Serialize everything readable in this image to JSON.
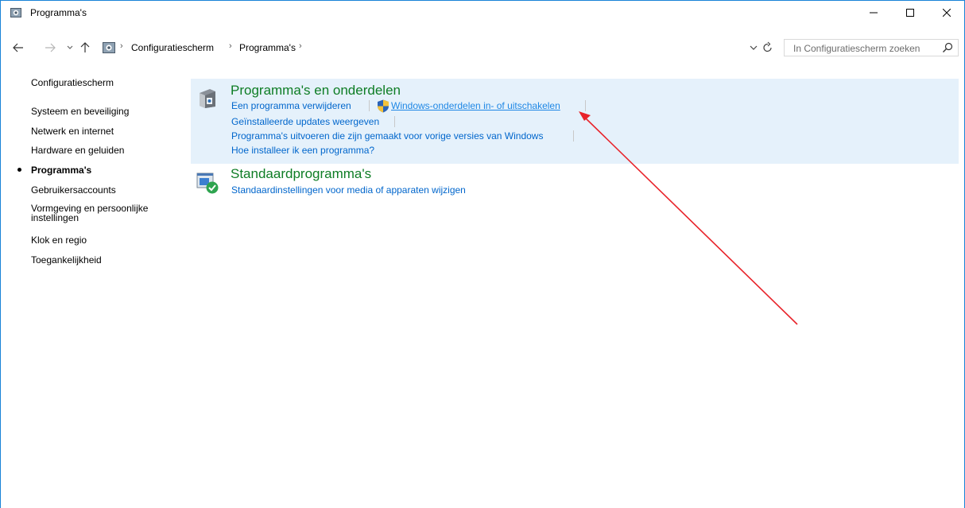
{
  "window": {
    "title": "Programma's",
    "minimize_icon": "minimize-icon",
    "maximize_icon": "maximize-icon",
    "close_icon": "close-icon"
  },
  "address_bar": {
    "breadcrumbs": [
      "Configuratiescherm",
      "Programma's"
    ],
    "search_placeholder": "In Configuratiescherm zoeken"
  },
  "sidebar": {
    "items": [
      {
        "label": "Configuratiescherm",
        "active": false
      },
      {
        "label": "Systeem en beveiliging",
        "active": false
      },
      {
        "label": "Netwerk en internet",
        "active": false
      },
      {
        "label": "Hardware en geluiden",
        "active": false
      },
      {
        "label": "Programma's",
        "active": true
      },
      {
        "label": "Gebruikersaccounts",
        "active": false
      },
      {
        "label": "Vormgeving en persoonlijke instellingen",
        "active": false
      },
      {
        "label": "Klok en regio",
        "active": false
      },
      {
        "label": "Toegankelijkheid",
        "active": false
      }
    ]
  },
  "categories": [
    {
      "title": "Programma's en onderdelen",
      "links": [
        "Een programma verwijderen",
        "Windows-onderdelen in- of uitschakelen",
        "Geïnstalleerde updates weergeven",
        "Programma's uitvoeren die zijn gemaakt voor vorige versies van Windows",
        "Hoe installeer ik een programma?"
      ]
    },
    {
      "title": "Standaardprogramma's",
      "links": [
        "Standaardinstellingen voor media of apparaten wijzigen"
      ]
    }
  ],
  "colors": {
    "category_title": "#0e7d25",
    "link": "#0066cc",
    "highlight_bg": "#e5f1fb",
    "arrow": "#e8232a"
  }
}
